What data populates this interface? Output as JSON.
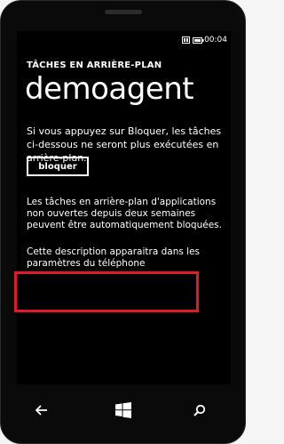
{
  "status_bar": {
    "time": "00:04",
    "icons": [
      "sim-icon",
      "battery-icon"
    ]
  },
  "app": {
    "title": "TÂCHES EN ARRIÈRE-PLAN",
    "page_title": "demoagent"
  },
  "content": {
    "description": "Si vous appuyez sur Bloquer, les tâches ci-dessous ne seront plus exécutées en arrière-plan.",
    "block_button_label": "bloquer",
    "auto_block_note": "Les tâches en arrière-plan d'applications non ouvertes depuis deux semaines peuvent être automatiquement bloquées.",
    "settings_description": "Cette description apparaitra dans les paramètres du téléphone"
  },
  "nav_bar": {
    "buttons": [
      "back-icon",
      "windows-start-icon",
      "search-icon"
    ]
  },
  "colors": {
    "screen_background": "#000000",
    "text": "#ffffff",
    "highlight": "#e0192e"
  }
}
